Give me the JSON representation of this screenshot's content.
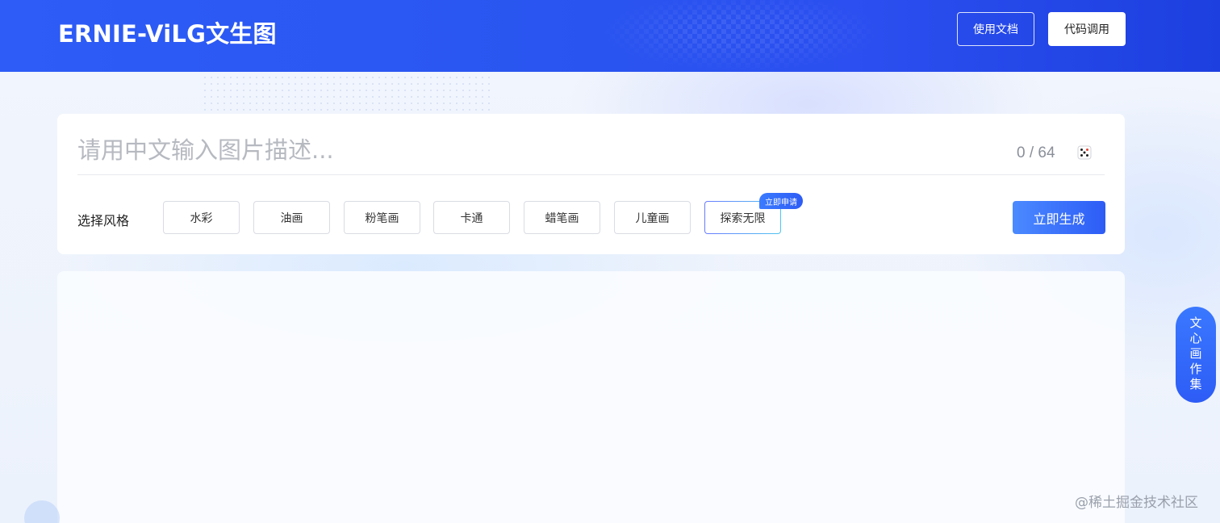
{
  "header": {
    "logo": "ERNIE-ViLG文生图",
    "docs_label": "使用文档",
    "code_label": "代码调用"
  },
  "input": {
    "placeholder": "请用中文输入图片描述...",
    "value": "",
    "counter": "0 / 64",
    "random_icon": "dice-icon"
  },
  "styles": {
    "label": "选择风格",
    "options": [
      "水彩",
      "油画",
      "粉笔画",
      "卡通",
      "蜡笔画",
      "儿童画",
      "探索无限"
    ],
    "explore_badge": "立即申请"
  },
  "generate_label": "立即生成",
  "gallery_label": "文心画作集",
  "watermark": "@稀土掘金技术社区",
  "colors": {
    "brand": "#2d5cf6",
    "header_bg": "#2a55f0"
  }
}
